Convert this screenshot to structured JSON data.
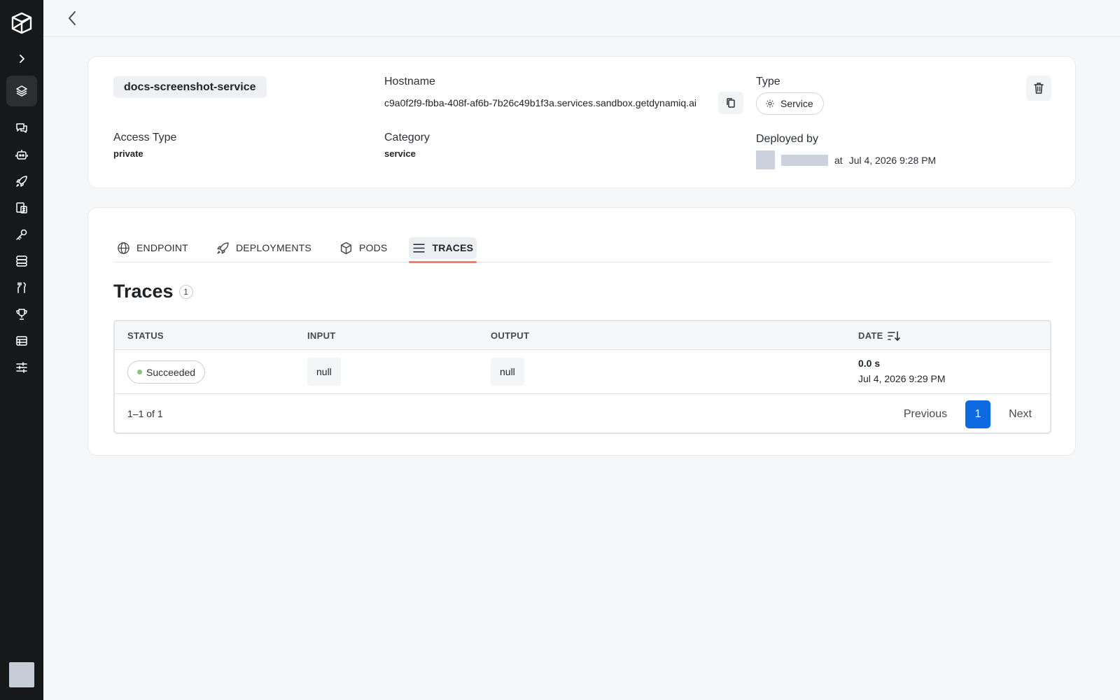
{
  "sidebar": {
    "logo_icon": "dynamiq-logo-icon",
    "expand_icon": "chevron-right-icon",
    "items": [
      {
        "icon": "layers-icon",
        "active": true
      },
      {
        "icon": "chat-icon"
      },
      {
        "icon": "bot-icon"
      },
      {
        "icon": "rocket-icon"
      },
      {
        "icon": "documents-icon"
      },
      {
        "icon": "key-icon"
      },
      {
        "icon": "database-icon"
      },
      {
        "icon": "tools-icon"
      },
      {
        "icon": "trophy-icon"
      },
      {
        "icon": "table-icon"
      },
      {
        "icon": "sliders-icon"
      }
    ]
  },
  "header": {
    "back_icon": "chevron-left-icon"
  },
  "service": {
    "name": "docs-screenshot-service",
    "hostname_label": "Hostname",
    "hostname": "c9a0f2f9-fbba-408f-af6b-7b26c49b1f3a.services.sandbox.getdynamiq.ai",
    "type_label": "Type",
    "type_value": "Service",
    "access_label": "Access Type",
    "access_value": "private",
    "category_label": "Category",
    "category_value": "service",
    "deployed_label": "Deployed by",
    "deployed_at_word": "at",
    "deployed_date": "Jul 4, 2026 9:28 PM"
  },
  "tabs": [
    {
      "label": "ENDPOINT",
      "icon": "globe-icon"
    },
    {
      "label": "DEPLOYMENTS",
      "icon": "rocket-icon"
    },
    {
      "label": "PODS",
      "icon": "cube-icon"
    },
    {
      "label": "TRACES",
      "icon": "list-icon",
      "active": true
    }
  ],
  "traces": {
    "title": "Traces",
    "count": "1",
    "columns": {
      "status": "STATUS",
      "input": "INPUT",
      "output": "OUTPUT",
      "date": "DATE"
    },
    "rows": [
      {
        "status": "Succeeded",
        "status_color": "#8bc47d",
        "input": "null",
        "output": "null",
        "duration": "0.0 s",
        "date": "Jul 4, 2026 9:29 PM"
      }
    ],
    "range_text": "1–1 of 1",
    "pagination": {
      "previous": "Previous",
      "page": "1",
      "next": "Next"
    }
  },
  "colors": {
    "accent": "#f07f63",
    "primary": "#0d6ae0",
    "sidebar": "#17181a"
  }
}
